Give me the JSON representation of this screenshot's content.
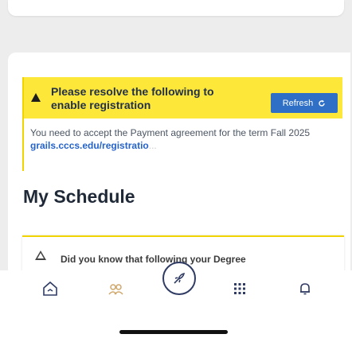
{
  "alert": {
    "title": "Please resolve the following to enable registration",
    "refresh_label": "Refresh",
    "message_prefix": "You need to accept the Payment agreement for the term Fall 2025 ",
    "link_text": "grails.cccs.edu/registratio",
    "ellipsis": "..."
  },
  "page": {
    "title": "My Schedule"
  },
  "notice": {
    "text": "Did you know that following your Degree"
  },
  "nav": {
    "items": [
      {
        "icon": "home-icon"
      },
      {
        "icon": "people-icon"
      },
      {
        "icon": "rocket-icon"
      },
      {
        "icon": "grid-icon"
      },
      {
        "icon": "bell-icon"
      }
    ]
  },
  "colors": {
    "alert_yellow": "#fde83a",
    "refresh_blue": "#2f6fc6",
    "nav_navy": "#2f3b63",
    "link_blue": "#2563c9"
  }
}
